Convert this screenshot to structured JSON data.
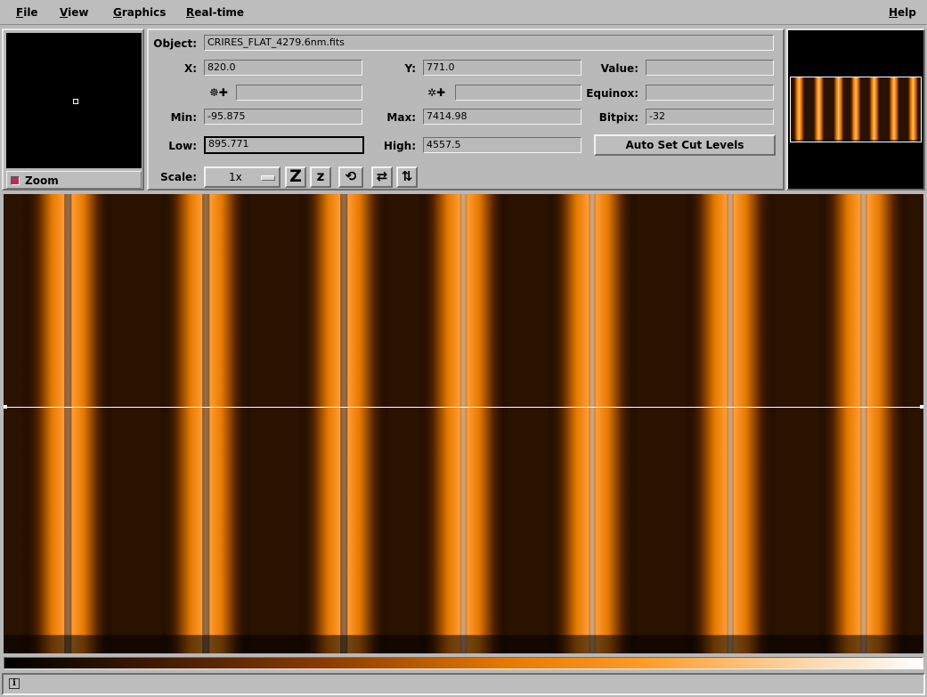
{
  "menu": {
    "file": "File",
    "view": "View",
    "graphics": "Graphics",
    "realtime": "Real-time",
    "help": "Help"
  },
  "zoom": {
    "label": "Zoom",
    "checked": true
  },
  "info": {
    "object_label": "Object:",
    "object_value": "CRIRES_FLAT_4279.6nm.fits",
    "x_label": "X:",
    "x_value": "820.0",
    "y_label": "Y:",
    "y_value": "771.0",
    "value_label": "Value:",
    "value_value": "",
    "ra_value": "",
    "dec_value": "",
    "equinox_label": "Equinox:",
    "equinox_value": "",
    "min_label": "Min:",
    "min_value": "-95.875",
    "max_label": "Max:",
    "max_value": "7414.98",
    "bitpix_label": "Bitpix:",
    "bitpix_value": "-32",
    "low_label": "Low:",
    "low_value": "895.771",
    "high_label": "High:",
    "high_value": "4557.5",
    "auto_cut_label": "Auto Set Cut Levels",
    "scale_label": "Scale:",
    "scale_value": "1x"
  },
  "tools": {
    "zoom_in_icon": "Z",
    "zoom_out_icon": "z",
    "rotate_icon": "⟲",
    "flip_x_icon": "⇄",
    "flip_y_icon": "⇅"
  },
  "image": {
    "colormap": [
      "#000000",
      "#e67a00",
      "#ffffff"
    ],
    "stripe_centers_fraction": [
      0.07,
      0.22,
      0.37,
      0.5,
      0.64,
      0.79,
      0.935
    ]
  },
  "status": {
    "icon": "i",
    "text": ""
  }
}
